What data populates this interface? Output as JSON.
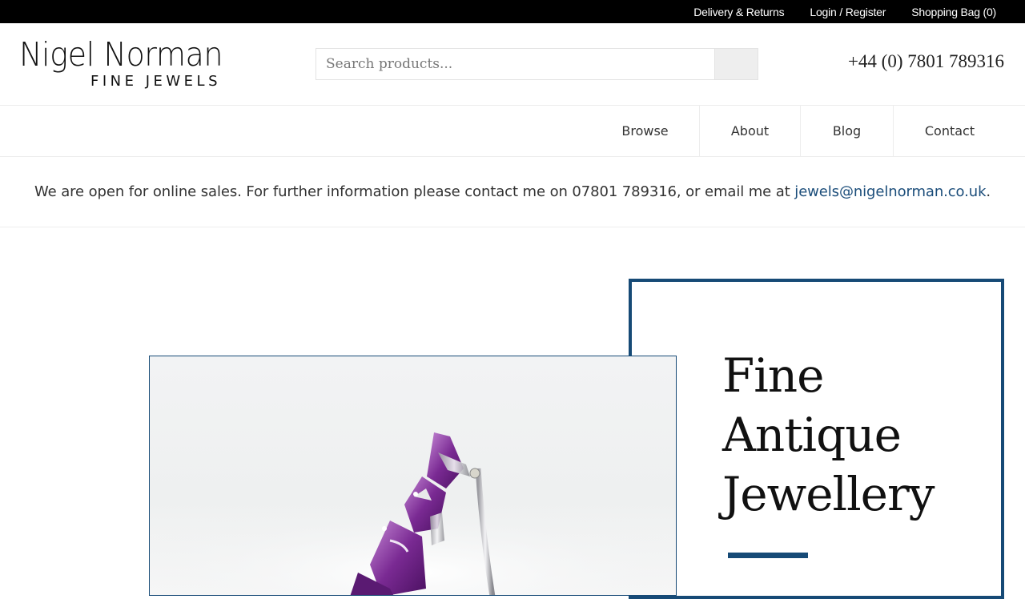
{
  "topbar": {
    "delivery": "Delivery & Returns",
    "login": "Login / Register",
    "bag": "Shopping Bag (0)"
  },
  "logo": {
    "line1": "Nigel Norman",
    "line2": "FINE JEWELS"
  },
  "search": {
    "placeholder": "Search products..."
  },
  "phone": "+44 (0) 7801 789316",
  "nav": {
    "browse": "Browse",
    "about": "About",
    "blog": "Blog",
    "contact": "Contact"
  },
  "notice": {
    "text": "We are open for online sales. For further information please contact me on 07801 789316, or email me at ",
    "email": "jewels@nigelnorman.co.uk",
    "end": "."
  },
  "hero": {
    "line1": "Fine",
    "line2": "Antique",
    "line3": "Jewellery"
  },
  "colors": {
    "brand": "#164a76",
    "link": "#1b4d7a",
    "topbar": "#000000"
  }
}
